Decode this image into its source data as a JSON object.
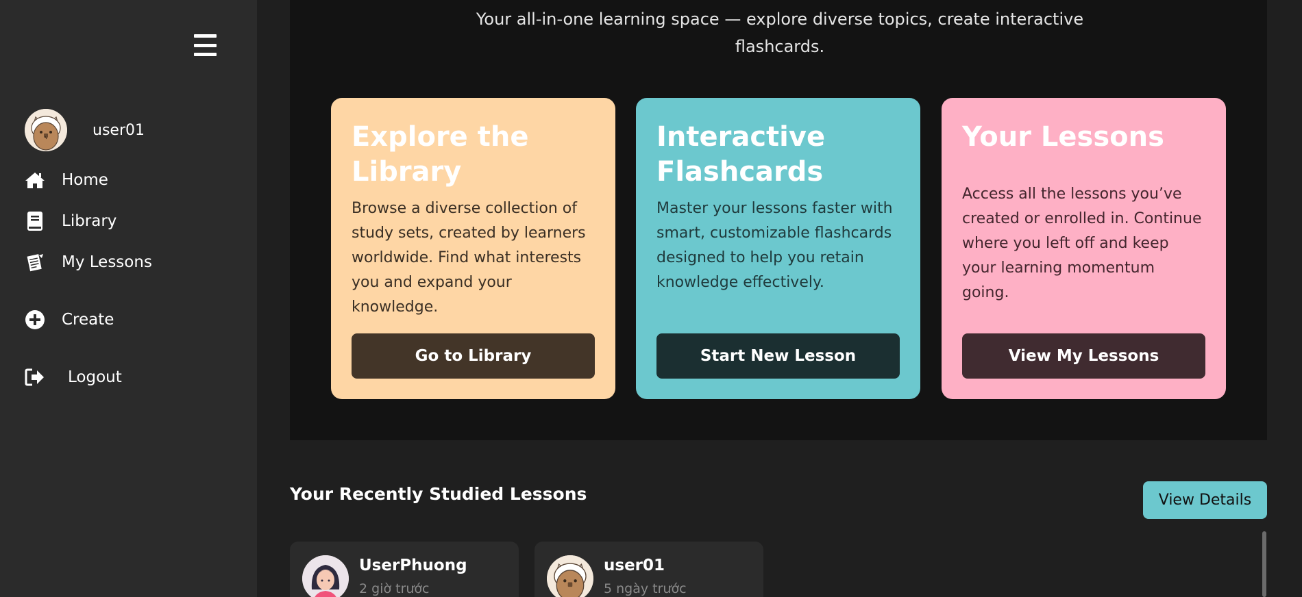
{
  "sidebar": {
    "menu_icon": "hamburger-menu-icon",
    "profile": {
      "username": "user01"
    },
    "nav": [
      {
        "label": "Home",
        "icon": "home-icon"
      },
      {
        "label": "Library",
        "icon": "book-icon"
      },
      {
        "label": "My Lessons",
        "icon": "notebook-icon"
      },
      {
        "label": "Create",
        "icon": "plus-circle-icon"
      },
      {
        "label": "Logout",
        "icon": "logout-icon"
      }
    ]
  },
  "hero": {
    "subtitle": "Your all-in-one learning space — explore diverse topics, create interactive flashcards.",
    "cards": [
      {
        "title": "Explore the Library",
        "description": "Browse a diverse collection of study sets, created by learners worldwide. Find what interests you and expand your knowledge.",
        "button": "Go to Library",
        "color": "#fed6a5",
        "button_color": "#433528"
      },
      {
        "title": "Interactive Flashcards",
        "description": "Master your lessons faster with smart, customizable flashcards designed to help you retain knowledge effectively.",
        "button": "Start New Lesson",
        "color": "#6cc8ce",
        "button_color": "#1b2f31"
      },
      {
        "title": "Your Lessons",
        "description": "Access all the lessons you’ve created or enrolled in. Continue where you left off and keep your learning momentum going.",
        "button": "View My Lessons",
        "color": "#feb0c5",
        "button_color": "#402b30"
      }
    ]
  },
  "recent": {
    "title": "Your Recently Studied Lessons",
    "view_details": "View Details",
    "lessons": [
      {
        "user": "UserPhuong",
        "time": "2 giờ trước"
      },
      {
        "user": "user01",
        "time": "5 ngày trước"
      }
    ]
  },
  "colors": {
    "background": "#1f1f1f",
    "sidebar": "#2b2b2b",
    "hero": "#131313",
    "accent": "#6cc8ce"
  }
}
